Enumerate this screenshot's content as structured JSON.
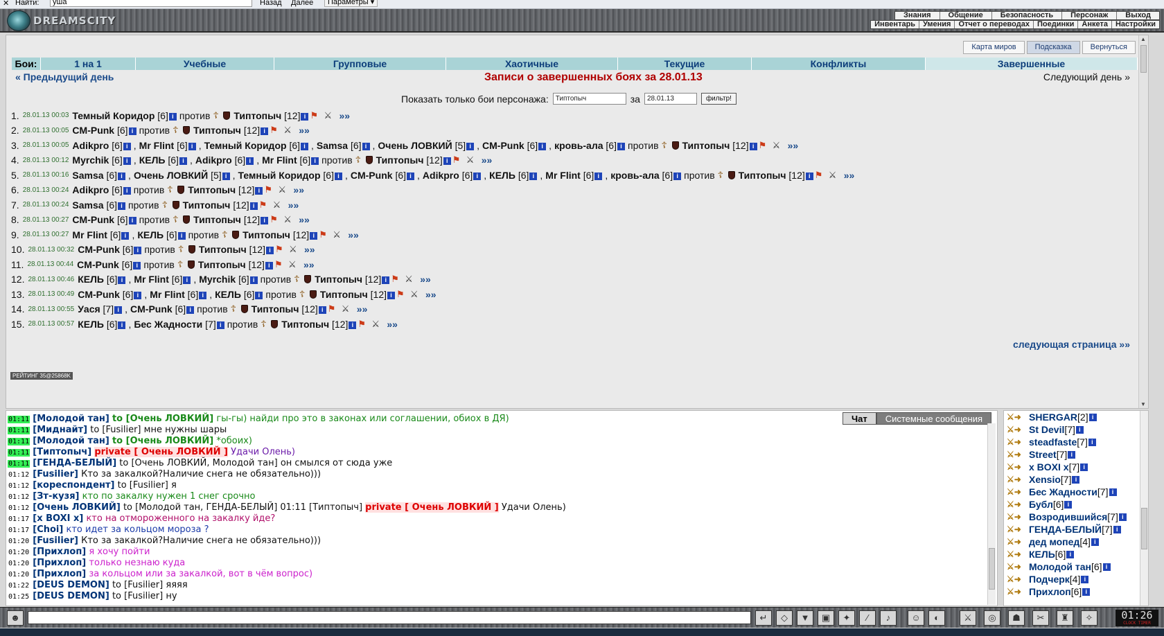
{
  "findbar": {
    "label": "Найти:",
    "value": "уша",
    "back": "Назад",
    "forward": "Далее",
    "params": "Параметры"
  },
  "header": {
    "logo": "DREAMSCITY",
    "menu1": [
      "Знания",
      "Общение",
      "Безопасность",
      "Персонаж",
      "Выход"
    ],
    "menu2": [
      "Инвентарь",
      "Умения",
      "Отчет о переводах",
      "Поединки",
      "Анкета",
      "Настройки"
    ]
  },
  "top_buttons": [
    "Карта миров",
    "Подсказка",
    "Вернуться"
  ],
  "tabs": {
    "label": "Бои:",
    "items": [
      "1 на 1",
      "Учебные",
      "Групповые",
      "Хаотичные",
      "Текущие",
      "Конфликты",
      "Завершенные"
    ]
  },
  "nav": {
    "prev": "« Предыдущий день",
    "title": "Записи о завершенных боях за 28.01.13",
    "next": "Следующий день »"
  },
  "filter": {
    "label": "Показать только бои персонажа:",
    "name_value": "Типтопыч",
    "date_label": "за",
    "date_value": "28.01.13",
    "button": "фильтр!"
  },
  "fights": [
    {
      "num": "1.",
      "time": "28.01.13 00:03",
      "team": [
        {
          "name": "Темный Коридор",
          "lvl": "[6]"
        }
      ],
      "opp": "Типтопыч",
      "opp_lvl": "[12]"
    },
    {
      "num": "2.",
      "time": "28.01.13 00:05",
      "team": [
        {
          "name": "CM-Punk",
          "lvl": "[6]"
        }
      ],
      "opp": "Типтопыч",
      "opp_lvl": "[12]"
    },
    {
      "num": "3.",
      "time": "28.01.13 00:05",
      "team": [
        {
          "name": "Adikpro",
          "lvl": "[6]"
        },
        {
          "name": "Mr Flint",
          "lvl": "[6]"
        },
        {
          "name": "Темный Коридор",
          "lvl": "[6]"
        },
        {
          "name": "Samsa",
          "lvl": "[6]"
        },
        {
          "name": "Очень ЛОВКИЙ",
          "lvl": "[5]"
        },
        {
          "name": "CM-Punk",
          "lvl": "[6]"
        },
        {
          "name": "кровь-ала",
          "lvl": "[6]"
        }
      ],
      "opp": "Типтопыч",
      "opp_lvl": "[12]"
    },
    {
      "num": "4.",
      "time": "28.01.13 00:12",
      "team": [
        {
          "name": "Myrchik",
          "lvl": "[6]"
        },
        {
          "name": "КЕЛЬ",
          "lvl": "[6]"
        },
        {
          "name": "Adikpro",
          "lvl": "[6]"
        },
        {
          "name": "Mr Flint",
          "lvl": "[6]"
        }
      ],
      "opp": "Типтопыч",
      "opp_lvl": "[12]"
    },
    {
      "num": "5.",
      "time": "28.01.13 00:16",
      "team": [
        {
          "name": "Samsa",
          "lvl": "[6]"
        },
        {
          "name": "Очень ЛОВКИЙ",
          "lvl": "[5]"
        },
        {
          "name": "Темный Коридор",
          "lvl": "[6]"
        },
        {
          "name": "CM-Punk",
          "lvl": "[6]"
        },
        {
          "name": "Adikpro",
          "lvl": "[6]"
        },
        {
          "name": "КЕЛЬ",
          "lvl": "[6]"
        },
        {
          "name": "Mr Flint",
          "lvl": "[6]"
        },
        {
          "name": "кровь-ала",
          "lvl": "[6]"
        }
      ],
      "opp": "Типтопыч",
      "opp_lvl": "[12]"
    },
    {
      "num": "6.",
      "time": "28.01.13 00:24",
      "team": [
        {
          "name": "Adikpro",
          "lvl": "[6]"
        }
      ],
      "opp": "Типтопыч",
      "opp_lvl": "[12]"
    },
    {
      "num": "7.",
      "time": "28.01.13 00:24",
      "team": [
        {
          "name": "Samsa",
          "lvl": "[6]"
        }
      ],
      "opp": "Типтопыч",
      "opp_lvl": "[12]"
    },
    {
      "num": "8.",
      "time": "28.01.13 00:27",
      "team": [
        {
          "name": "CM-Punk",
          "lvl": "[6]"
        }
      ],
      "opp": "Типтопыч",
      "opp_lvl": "[12]"
    },
    {
      "num": "9.",
      "time": "28.01.13 00:27",
      "team": [
        {
          "name": "Mr Flint",
          "lvl": "[6]"
        },
        {
          "name": "КЕЛЬ",
          "lvl": "[6]"
        }
      ],
      "opp": "Типтопыч",
      "opp_lvl": "[12]"
    },
    {
      "num": "10.",
      "time": "28.01.13 00:32",
      "team": [
        {
          "name": "CM-Punk",
          "lvl": "[6]"
        }
      ],
      "opp": "Типтопыч",
      "opp_lvl": "[12]"
    },
    {
      "num": "11.",
      "time": "28.01.13 00:44",
      "team": [
        {
          "name": "CM-Punk",
          "lvl": "[6]"
        }
      ],
      "opp": "Типтопыч",
      "opp_lvl": "[12]"
    },
    {
      "num": "12.",
      "time": "28.01.13 00:46",
      "team": [
        {
          "name": "КЕЛЬ",
          "lvl": "[6]"
        },
        {
          "name": "Mr Flint",
          "lvl": "[6]"
        },
        {
          "name": "Myrchik",
          "lvl": "[6]"
        }
      ],
      "opp": "Типтопыч",
      "opp_lvl": "[12]"
    },
    {
      "num": "13.",
      "time": "28.01.13 00:49",
      "team": [
        {
          "name": "CM-Punk",
          "lvl": "[6]"
        },
        {
          "name": "Mr Flint",
          "lvl": "[6]"
        },
        {
          "name": "КЕЛЬ",
          "lvl": "[6]"
        }
      ],
      "opp": "Типтопыч",
      "opp_lvl": "[12]"
    },
    {
      "num": "14.",
      "time": "28.01.13 00:55",
      "team": [
        {
          "name": "Уася",
          "lvl": "[7]"
        },
        {
          "name": "CM-Punk",
          "lvl": "[6]"
        }
      ],
      "opp": "Типтопыч",
      "opp_lvl": "[12]"
    },
    {
      "num": "15.",
      "time": "28.01.13 00:57",
      "team": [
        {
          "name": "КЕЛЬ",
          "lvl": "[6]"
        },
        {
          "name": "Бес Жадности",
          "lvl": "[7]"
        }
      ],
      "opp": "Типтопыч",
      "opp_lvl": "[12]"
    }
  ],
  "fight_words": {
    "vs": "против",
    "more": "»»",
    "info": "i"
  },
  "next_page": "следующая страница »»",
  "rating": "РЕЙТИНГ 35@25868K",
  "chat": {
    "tabs": [
      "Чат",
      "Системные сообщения"
    ],
    "lines": [
      {
        "t": "01:11",
        "hl": true,
        "nick": "[Молодой тан]",
        "to": "to [Очень ЛОВКИЙ]",
        "msg": "гы-гы) найди про это в законах или соглашении, обиох в ДЯ)",
        "color": "#1a8a1a",
        "to_color": "#1a8a1a"
      },
      {
        "t": "01:11",
        "hl": true,
        "nick": "[Миднайт]",
        "to": "to [Fusilier]",
        "msg": "мне нужны шары",
        "color": "#111",
        "to_color": "#111"
      },
      {
        "t": "01:11",
        "hl": true,
        "nick": "[Молодой тан]",
        "to": "to [Очень ЛОВКИЙ]",
        "msg": "*обоих)",
        "color": "#1a8a1a",
        "to_color": "#1a8a1a"
      },
      {
        "t": "01:11",
        "hl": true,
        "nick": "[Типтопыч]",
        "priv": "private [ Очень ЛОВКИЙ ]",
        "msg": "Удачи Олень)",
        "color": "#6a1aa8"
      },
      {
        "t": "01:11",
        "hl": true,
        "nick": "[ГЕНДА-БЕЛЫЙ]",
        "to": "to [Очень ЛОВКИЙ, Молодой тан]",
        "msg": "он смылся от сюда уже",
        "color": "#111",
        "to_color": "#111"
      },
      {
        "t": "01:12",
        "nick": "[Fusilier]",
        "msg": "Кто за закалкой?Наличие снега не обязательно)))",
        "color": "#111"
      },
      {
        "t": "01:12",
        "nick": "[кореспондент]",
        "to": "to [Fusilier]",
        "msg": "я",
        "color": "#111",
        "to_color": "#111"
      },
      {
        "t": "01:12",
        "nick": "[Зт-кузя]",
        "msg": "кто по закалку нужен 1 снег срочно",
        "color": "#1a8a1a"
      },
      {
        "t": "01:12",
        "nick": "[Очень ЛОВКИЙ]",
        "to": "to [Молодой тан, ГЕНДА-БЕЛЫЙ] 01:11 [Типтопыч]",
        "priv": "private [ Очень ЛОВКИЙ ]",
        "msg": "Удачи Олень)",
        "color": "#111",
        "to_color": "#111"
      },
      {
        "t": "01:17",
        "nick": "[x BOXI x]",
        "msg": "кто на отмороженного на закалку йде?",
        "color": "#b0106a"
      },
      {
        "t": "01:17",
        "nick": "[Choi]",
        "msg": "кто идет за кольцом мороза ?",
        "color": "#1a3aa8"
      },
      {
        "t": "01:20",
        "nick": "[Fusilier]",
        "msg": "Кто за закалкой?Наличие снега не обязательно)))",
        "color": "#111"
      },
      {
        "t": "01:20",
        "nick": "[Прихлоп]",
        "msg": "я хочу пойти",
        "color": "#cc22cc"
      },
      {
        "t": "01:20",
        "nick": "[Прихлоп]",
        "msg": "только незнаю куда",
        "color": "#cc22cc"
      },
      {
        "t": "01:20",
        "nick": "[Прихлоп]",
        "msg": "за кольцом или за закалкой, вот в чём вопрос)",
        "color": "#cc22cc"
      },
      {
        "t": "01:22",
        "nick": "[DEUS DEMON]",
        "to": "to [Fusilier]",
        "msg": "яяяя",
        "color": "#111",
        "to_color": "#111"
      },
      {
        "t": "01:25",
        "nick": "[DEUS DEMON]",
        "to": "to [Fusilier]",
        "msg": "ну",
        "color": "#111",
        "to_color": "#111"
      }
    ]
  },
  "online": [
    {
      "name": "SHERGAR",
      "lvl": "[2]"
    },
    {
      "name": "St Devil",
      "lvl": "[7]"
    },
    {
      "name": "steadfaste",
      "lvl": "[7]"
    },
    {
      "name": "Street",
      "lvl": "[7]"
    },
    {
      "name": "x BOXI x",
      "lvl": "[7]"
    },
    {
      "name": "Xensio",
      "lvl": "[7]"
    },
    {
      "name": "Бес Жадности",
      "lvl": "[7]"
    },
    {
      "name": "Бубл",
      "lvl": "[6]"
    },
    {
      "name": "Возродившийся",
      "lvl": "[7]"
    },
    {
      "name": "ГЕНДА-БЕЛЫЙ",
      "lvl": "[7]"
    },
    {
      "name": "дед мопед",
      "lvl": "[4]"
    },
    {
      "name": "КЕЛЬ",
      "lvl": "[6]"
    },
    {
      "name": "Молодой тан",
      "lvl": "[6]"
    },
    {
      "name": "Подчерк",
      "lvl": "[4]"
    },
    {
      "name": "Прихлоп",
      "lvl": "[6]"
    }
  ],
  "clock": {
    "time": "01:26",
    "sub": "CLOCK TIMER"
  }
}
